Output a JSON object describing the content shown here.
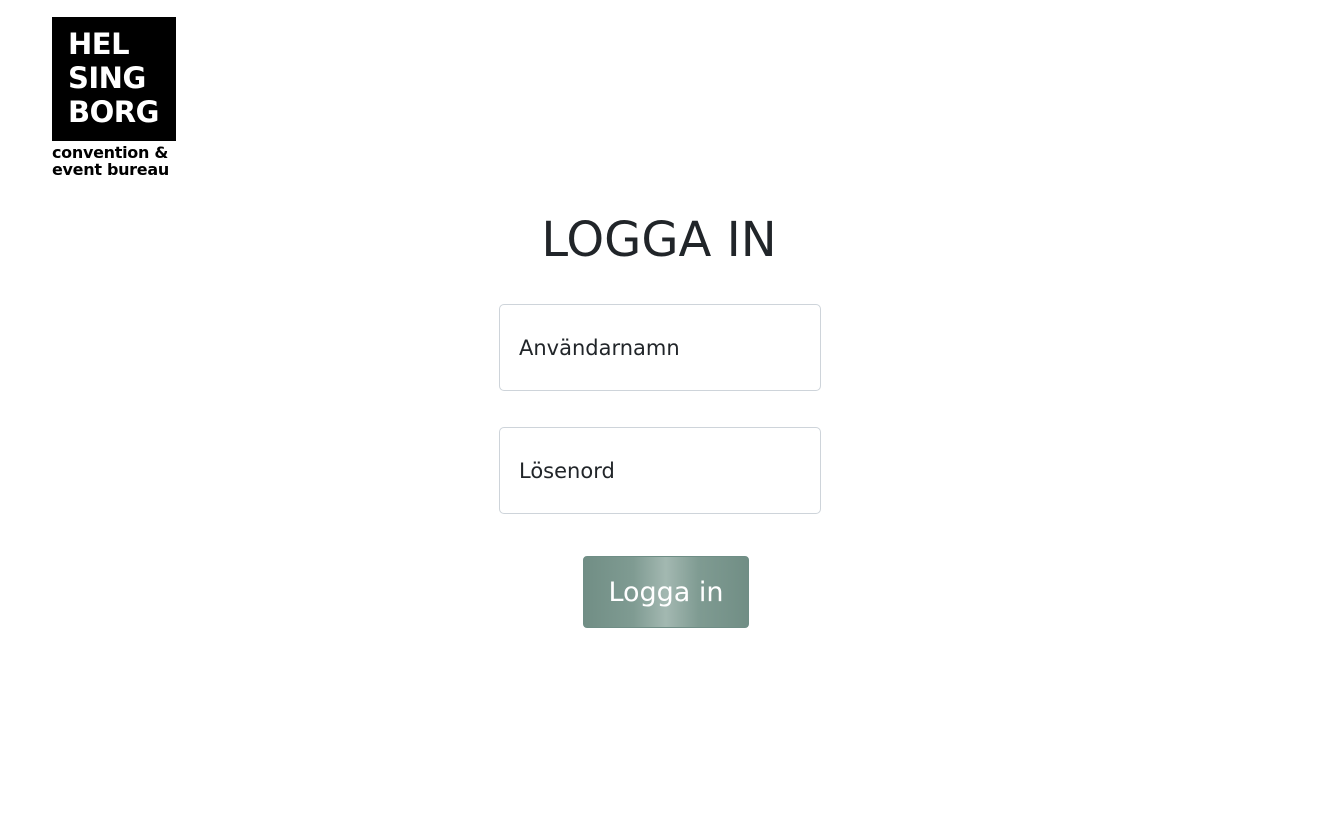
{
  "logo": {
    "lines": [
      "HEL",
      "SING",
      "BORG"
    ],
    "subtitle_line1": "convention &",
    "subtitle_line2": "event bureau"
  },
  "login": {
    "title": "LOGGA IN",
    "username_placeholder": "Användarnamn",
    "password_placeholder": "Lösenord",
    "submit_label": "Logga in"
  },
  "colors": {
    "button_accent": "#7f9b92",
    "text": "#212529",
    "input_border": "#ced4da"
  }
}
